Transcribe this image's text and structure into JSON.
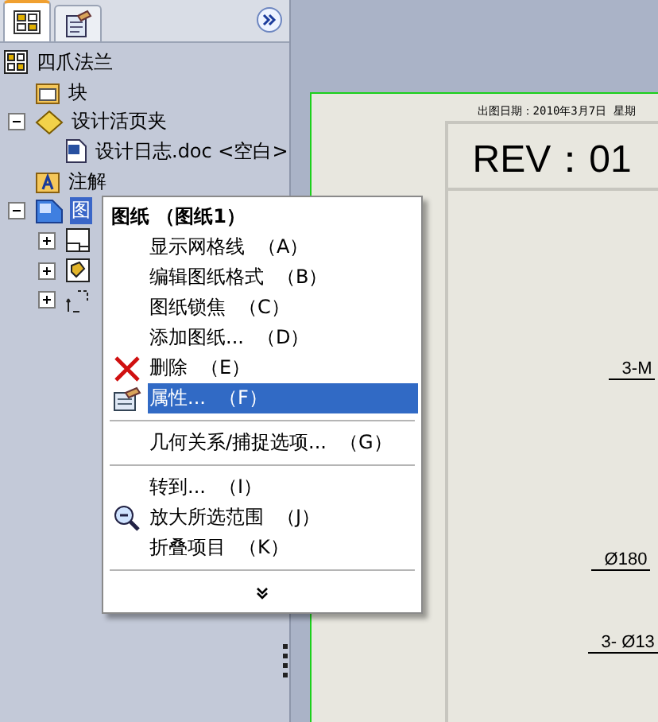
{
  "panel_tabs": [
    {
      "kind": "tree",
      "selected": true
    },
    {
      "kind": "notes",
      "selected": false
    }
  ],
  "tree": {
    "label": "四爪法兰",
    "kind": "part",
    "children": [
      {
        "label": "块",
        "kind": "blocks"
      },
      {
        "label": "设计活页夹",
        "kind": "binder",
        "expanded": true,
        "children": [
          {
            "label": "设计日志.doc <空白>",
            "kind": "doc"
          }
        ]
      },
      {
        "label": "注解",
        "kind": "annotations"
      },
      {
        "label": "图",
        "kind": "sheet",
        "expanded": true,
        "selected": true,
        "children": [
          {
            "kind": "format",
            "expanded": false
          },
          {
            "kind": "view",
            "expanded": false
          },
          {
            "kind": "relations",
            "expanded": false
          }
        ]
      }
    ]
  },
  "drawing": {
    "date": "出图日期：2010年3月7日 星期",
    "rev": "REV：01",
    "labels": [
      "3-M",
      "Ø180",
      "3- Ø13"
    ]
  },
  "menu": [
    {
      "kind": "header",
      "label": "图纸 （图纸1）"
    },
    {
      "kind": "item",
      "label": "显示网格线",
      "key": "（A）",
      "selected": false
    },
    {
      "kind": "item",
      "label": "编辑图纸格式",
      "key": "（B）",
      "selected": false
    },
    {
      "kind": "item",
      "label": "图纸锁焦",
      "key": "（C）",
      "selected": false
    },
    {
      "kind": "item",
      "label": "添加图纸...",
      "key": "（D）",
      "selected": false
    },
    {
      "kind": "delete",
      "label": "删除",
      "key": "（E）",
      "selected": false
    },
    {
      "kind": "properties",
      "label": "属性...",
      "key": "（F）",
      "selected": true
    },
    {
      "kind": "separator"
    },
    {
      "kind": "item",
      "label": "几何关系/捕捉选项...",
      "key": "（G）",
      "selected": false
    },
    {
      "kind": "separator"
    },
    {
      "kind": "item",
      "label": "转到...",
      "key": "（I）",
      "selected": false
    },
    {
      "kind": "zoom",
      "label": "放大所选范围",
      "key": "（J）",
      "selected": false
    },
    {
      "kind": "item",
      "label": "折叠项目",
      "key": "（K）",
      "selected": false
    },
    {
      "kind": "separator"
    },
    {
      "kind": "more"
    }
  ]
}
